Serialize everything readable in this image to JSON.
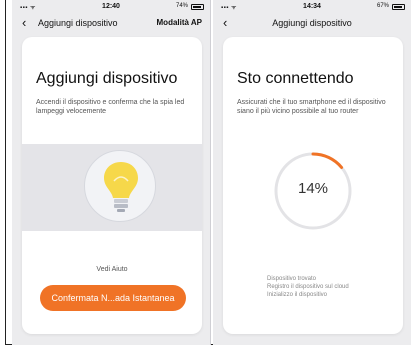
{
  "left_screen": {
    "status": {
      "signal": "▪▪▪ ᯤ",
      "time": "12:40",
      "battery": "74%"
    },
    "nav": {
      "back": "‹",
      "title": "Aggiungi dispositivo",
      "action": "Modalità AP"
    },
    "heading": "Aggiungi dispositivo",
    "description": "Accendi il dispositivo e conferma che la spia led lampeggi velocemente",
    "illustration_icon": "lightbulb-icon",
    "help_link": "Vedi Aiuto",
    "confirm_button": "Confermata N...ada Istantanea",
    "accent_color": "#f07326"
  },
  "right_screen": {
    "status": {
      "signal": "▪▪▪ ᯤ",
      "time": "14:34",
      "battery": "67%"
    },
    "nav": {
      "back": "‹",
      "title": "Aggiungi dispositivo"
    },
    "heading": "Sto connettendo",
    "description": "Assicurati che il tuo smartphone ed il dispositivo siano il più vicino possibile al tuo router",
    "progress": {
      "value": 0.14,
      "label": "14%"
    },
    "steps": [
      "Dispositivo trovato",
      "Registro il dispositivo sul cloud",
      "Inizializzo il dispositivo"
    ]
  }
}
